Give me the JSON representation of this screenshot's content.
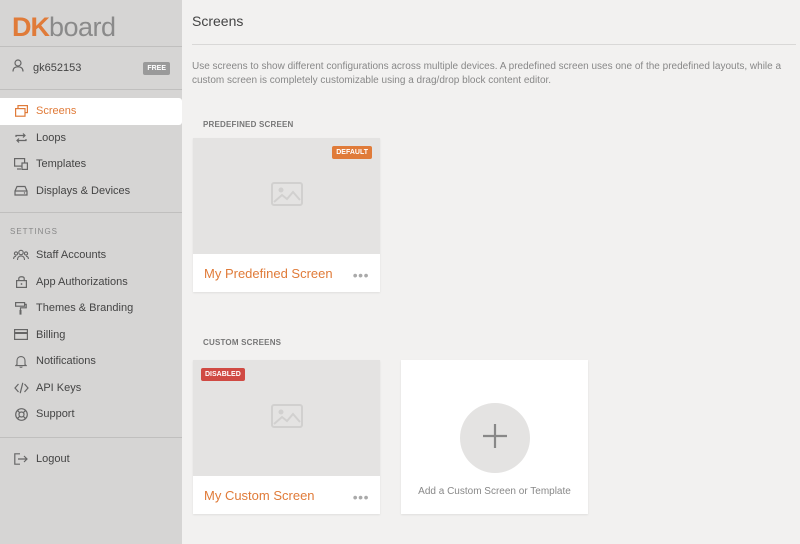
{
  "brand": {
    "logo_dk": "DK",
    "logo_board": "board",
    "accent": "#e07b39"
  },
  "user": {
    "name": "gk652153",
    "plan_badge": "FREE"
  },
  "sidebar": {
    "items": [
      {
        "label": "Screens",
        "icon": "screens-icon",
        "active": true
      },
      {
        "label": "Loops",
        "icon": "loop-icon"
      },
      {
        "label": "Templates",
        "icon": "templates-icon"
      },
      {
        "label": "Displays & Devices",
        "icon": "devices-icon"
      }
    ],
    "settings_label": "SETTINGS",
    "settings_items": [
      {
        "label": "Staff Accounts",
        "icon": "people-icon"
      },
      {
        "label": "App Authorizations",
        "icon": "lock-icon"
      },
      {
        "label": "Themes & Branding",
        "icon": "paint-roller-icon"
      },
      {
        "label": "Billing",
        "icon": "credit-card-icon"
      },
      {
        "label": "Notifications",
        "icon": "bell-icon"
      },
      {
        "label": "API Keys",
        "icon": "code-icon"
      },
      {
        "label": "Support",
        "icon": "lifebuoy-icon"
      }
    ],
    "logout": {
      "label": "Logout",
      "icon": "logout-icon"
    }
  },
  "main": {
    "title": "Screens",
    "description": "Use screens to show different configurations across multiple devices. A predefined screen uses one of the predefined layouts, while a custom screen is completely customizable using a drag/drop block content editor.",
    "predefined_label": "PREDEFINED SCREEN",
    "predefined_card": {
      "name": "My Predefined Screen",
      "tag": "DEFAULT",
      "more": "•••"
    },
    "custom_label": "CUSTOM SCREENS",
    "custom_card": {
      "name": "My Custom Screen",
      "tag": "DISABLED",
      "more": "•••"
    },
    "add_card": {
      "label": "Add a Custom Screen or Template",
      "plus": "+"
    }
  }
}
